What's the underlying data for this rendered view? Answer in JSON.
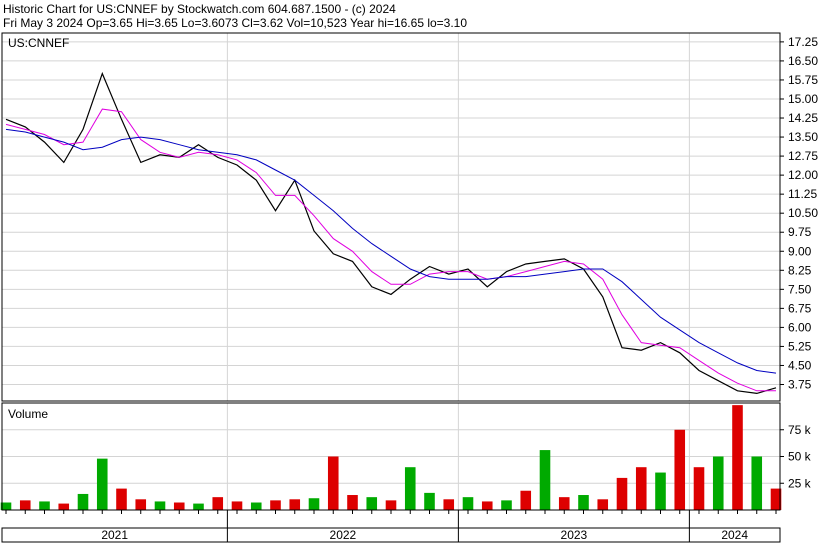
{
  "header": {
    "line1": "Historic Chart for US:CNNEF by Stockwatch.com 604.687.1500 - (c) 2024",
    "line2": "Fri May  3 2024  Op=3.65  Hi=3.65  Lo=3.6073  Cl=3.62  Vol=10,523  Year hi=16.65  lo=3.10"
  },
  "chart_data": [
    {
      "type": "line",
      "panel": "price",
      "title": "US:CNNEF",
      "ylim": [
        3.1,
        17.6
      ],
      "yticks": [
        17.25,
        16.5,
        15.75,
        15.0,
        14.25,
        13.5,
        12.75,
        12.0,
        11.25,
        10.5,
        9.75,
        9.0,
        8.25,
        7.5,
        6.75,
        6.0,
        5.25,
        4.5,
        3.75
      ],
      "ytick_labels": [
        "17.25",
        "16.50",
        "15.75",
        "15.00",
        "14.25",
        "13.50",
        "12.75",
        "12.00",
        "11.25",
        "10.50",
        "9.75",
        "9.00",
        "8.25",
        "7.50",
        "6.75",
        "6.00",
        "5.25",
        "4.50",
        "3.75"
      ],
      "x": [
        "2021-01",
        "2021-02",
        "2021-03",
        "2021-04",
        "2021-05",
        "2021-06",
        "2021-07",
        "2021-08",
        "2021-09",
        "2021-10",
        "2021-11",
        "2021-12",
        "2022-01",
        "2022-02",
        "2022-03",
        "2022-04",
        "2022-05",
        "2022-06",
        "2022-07",
        "2022-08",
        "2022-09",
        "2022-10",
        "2022-11",
        "2022-12",
        "2023-01",
        "2023-02",
        "2023-03",
        "2023-04",
        "2023-05",
        "2023-06",
        "2023-07",
        "2023-08",
        "2023-09",
        "2023-10",
        "2023-11",
        "2023-12",
        "2024-01",
        "2024-02",
        "2024-03",
        "2024-04",
        "2024-05"
      ],
      "series": [
        {
          "values": [
            14.2,
            13.9,
            13.3,
            12.5,
            13.8,
            16.0,
            14.2,
            12.5,
            12.8,
            12.7,
            13.2,
            12.7,
            12.4,
            11.8,
            10.6,
            11.8,
            9.8,
            8.9,
            8.6,
            7.6,
            7.3,
            7.9,
            8.4,
            8.1,
            8.3,
            7.6,
            8.2,
            8.5,
            8.6,
            8.7,
            8.3,
            7.2,
            5.2,
            5.1,
            5.4,
            5.0,
            4.3,
            3.9,
            3.5,
            3.4,
            3.62
          ],
          "color": "#000000"
        },
        {
          "values": [
            14.0,
            13.8,
            13.6,
            13.2,
            13.3,
            14.6,
            14.5,
            13.4,
            12.9,
            12.7,
            12.9,
            12.8,
            12.6,
            12.1,
            11.2,
            11.2,
            10.4,
            9.5,
            9.0,
            8.2,
            7.7,
            7.7,
            8.1,
            8.2,
            8.2,
            7.9,
            8.0,
            8.2,
            8.4,
            8.6,
            8.5,
            7.9,
            6.5,
            5.4,
            5.3,
            5.2,
            4.7,
            4.2,
            3.8,
            3.5,
            3.5
          ],
          "color": "#e000e0"
        },
        {
          "values": [
            13.8,
            13.7,
            13.5,
            13.3,
            13.0,
            13.1,
            13.4,
            13.5,
            13.4,
            13.2,
            13.0,
            12.9,
            12.8,
            12.6,
            12.2,
            11.8,
            11.2,
            10.6,
            9.9,
            9.3,
            8.8,
            8.3,
            8.0,
            7.9,
            7.9,
            7.9,
            8.0,
            8.0,
            8.1,
            8.2,
            8.3,
            8.3,
            7.8,
            7.1,
            6.4,
            5.9,
            5.4,
            5.0,
            4.6,
            4.3,
            4.2
          ],
          "color": "#0000c0"
        }
      ]
    },
    {
      "type": "bar",
      "panel": "volume",
      "title": "Volume",
      "ylim": [
        0,
        100000
      ],
      "yticks": [
        25000,
        50000,
        75000
      ],
      "ytick_labels": [
        "25 k",
        "50 k",
        "75 k"
      ],
      "x": [
        "2021-01",
        "2021-02",
        "2021-03",
        "2021-04",
        "2021-05",
        "2021-06",
        "2021-07",
        "2021-08",
        "2021-09",
        "2021-10",
        "2021-11",
        "2021-12",
        "2022-01",
        "2022-02",
        "2022-03",
        "2022-04",
        "2022-05",
        "2022-06",
        "2022-07",
        "2022-08",
        "2022-09",
        "2022-10",
        "2022-11",
        "2022-12",
        "2023-01",
        "2023-02",
        "2023-03",
        "2023-04",
        "2023-05",
        "2023-06",
        "2023-07",
        "2023-08",
        "2023-09",
        "2023-10",
        "2023-11",
        "2023-12",
        "2024-01",
        "2024-02",
        "2024-03",
        "2024-04",
        "2024-05"
      ],
      "values": [
        7000,
        9000,
        8000,
        6000,
        15000,
        48000,
        20000,
        10000,
        8000,
        7000,
        6000,
        12000,
        8000,
        7000,
        9000,
        10000,
        11000,
        50000,
        14000,
        12000,
        9000,
        40000,
        16000,
        10000,
        12000,
        8000,
        9000,
        18000,
        56000,
        12000,
        14000,
        10000,
        30000,
        40000,
        35000,
        75000,
        40000,
        50000,
        98000,
        50000,
        20000
      ],
      "colors": [
        "#00aa00",
        "#dd0000",
        "#00aa00",
        "#dd0000",
        "#00aa00",
        "#00aa00",
        "#dd0000",
        "#dd0000",
        "#00aa00",
        "#dd0000",
        "#00aa00",
        "#dd0000",
        "#dd0000",
        "#00aa00",
        "#dd0000",
        "#dd0000",
        "#00aa00",
        "#dd0000",
        "#dd0000",
        "#00aa00",
        "#dd0000",
        "#00aa00",
        "#00aa00",
        "#dd0000",
        "#00aa00",
        "#dd0000",
        "#00aa00",
        "#dd0000",
        "#00aa00",
        "#dd0000",
        "#00aa00",
        "#dd0000",
        "#dd0000",
        "#dd0000",
        "#00aa00",
        "#dd0000",
        "#dd0000",
        "#00aa00",
        "#dd0000",
        "#00aa00",
        "#dd0000"
      ]
    }
  ],
  "xaxis": {
    "year_labels": [
      "2021",
      "2022",
      "2023",
      "2024"
    ]
  }
}
